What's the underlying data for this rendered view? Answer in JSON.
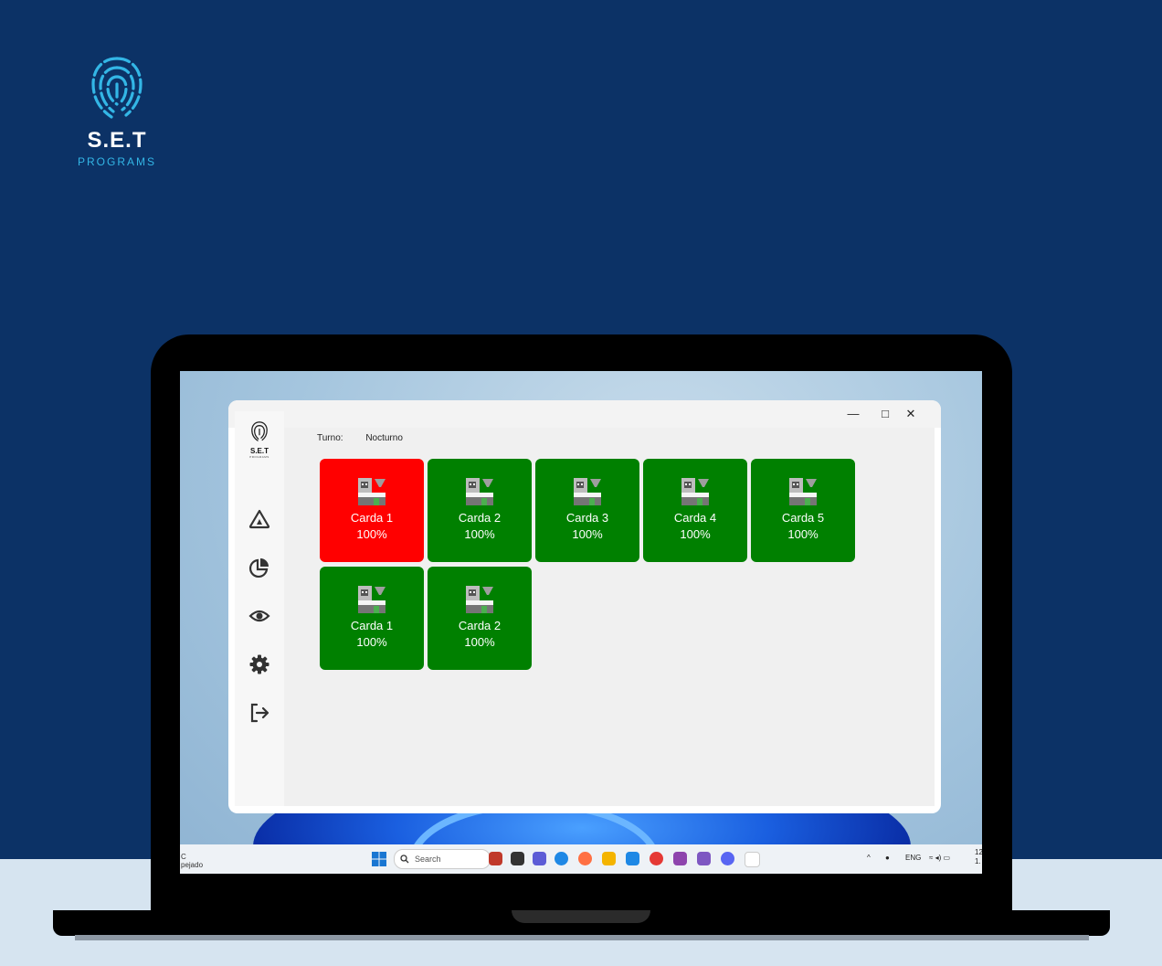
{
  "brand": {
    "name": "S.E.T",
    "sub": "PROGRAMS"
  },
  "app": {
    "logo_name": "S.E.T",
    "logo_sub": "PROGRAMS",
    "window_controls": {
      "minimize": "—",
      "maximize": "□",
      "close": "✕"
    },
    "turno_label": "Turno:",
    "turno_value": "Nocturno",
    "nav_icons": [
      "alert-triangle-icon",
      "pie-chart-icon",
      "eye-icon",
      "gear-icon",
      "logout-icon"
    ],
    "tiles": [
      {
        "label": "Carda 1",
        "pct": "100%",
        "color": "#ff0000"
      },
      {
        "label": "Carda 2",
        "pct": "100%",
        "color": "#008000"
      },
      {
        "label": "Carda 3",
        "pct": "100%",
        "color": "#008000"
      },
      {
        "label": "Carda 4",
        "pct": "100%",
        "color": "#008000"
      },
      {
        "label": "Carda 5",
        "pct": "100%",
        "color": "#008000"
      },
      {
        "label": "Carda 1",
        "pct": "100%",
        "color": "#008000"
      },
      {
        "label": "Carda 2",
        "pct": "100%",
        "color": "#008000"
      }
    ]
  },
  "taskbar": {
    "weather_line1": "C",
    "weather_line2": "pejado",
    "search_placeholder": "Search",
    "lang": "ENG",
    "clock_line1": "12",
    "clock_line2": "1."
  },
  "colors": {
    "background": "#0c3266",
    "accent": "#33b6e6",
    "ok": "#008000",
    "alarm": "#ff0000"
  }
}
